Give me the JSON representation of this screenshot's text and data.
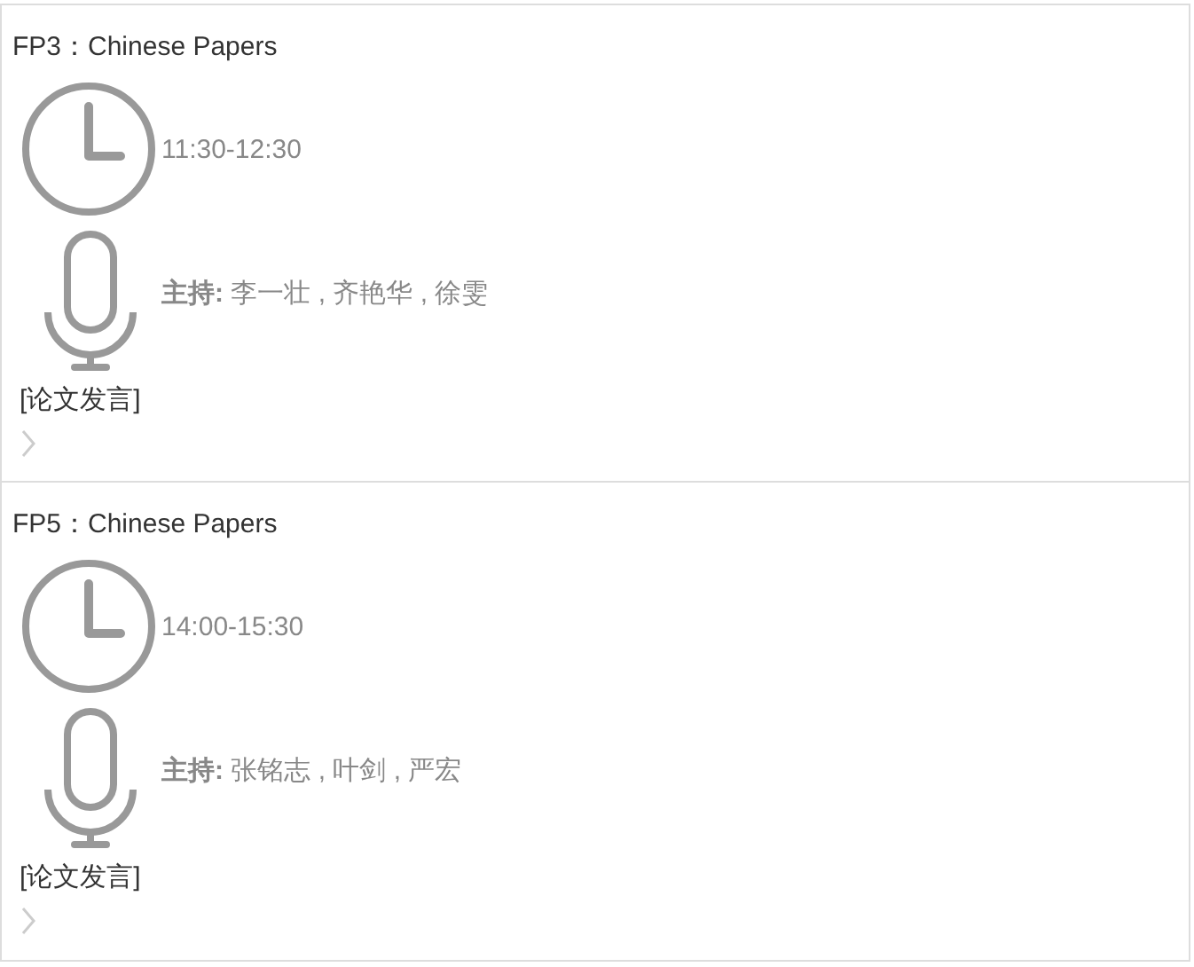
{
  "sessions": [
    {
      "title": "FP3：Chinese Papers",
      "time": "11:30-12:30",
      "hosts": "**主持:** 李一壮 , 齐艳华 , 徐雯",
      "tag": "[论文发言]"
    },
    {
      "title": "FP5：Chinese Papers",
      "time": "14:00-15:30",
      "hosts": "**主持:** 张铭志 , 叶剑 , 严宏",
      "tag": "[论文发言]"
    }
  ]
}
